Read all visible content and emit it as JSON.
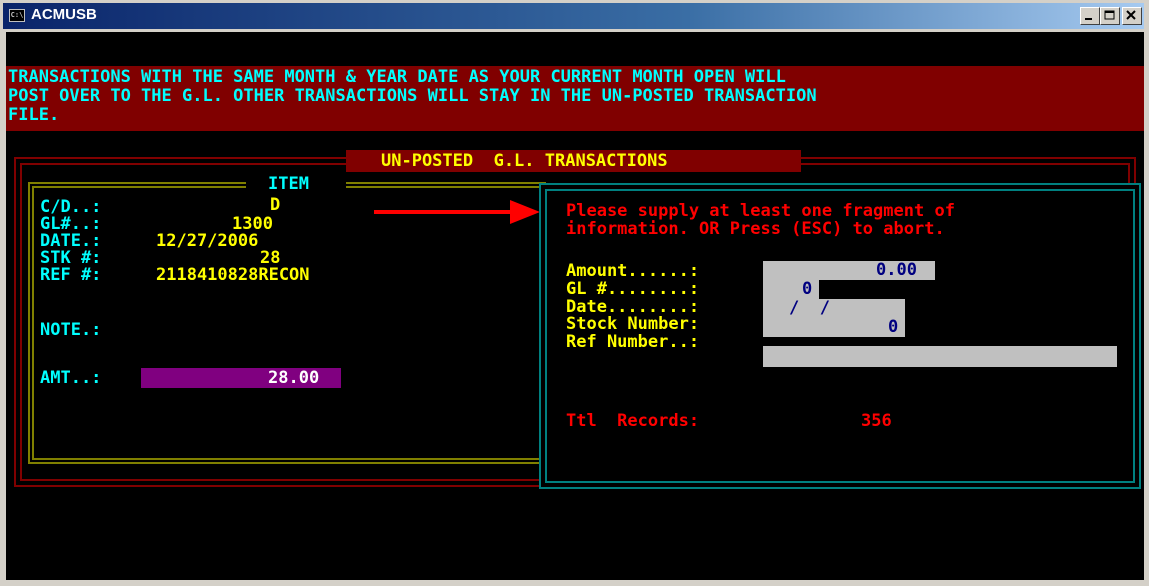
{
  "window": {
    "title": "ACMUSB",
    "icon": "console-icon",
    "icon_text": "C:\\"
  },
  "banner": {
    "lines": [
      "TRANSACTIONS WITH THE SAME MONTH & YEAR DATE AS YOUR CURRENT MONTH OPEN WILL",
      "POST OVER TO THE G.L. OTHER TRANSACTIONS WILL STAY IN THE UN-POSTED TRANSACTION",
      "FILE."
    ]
  },
  "panel_title": "UN-POSTED  G.L. TRANSACTIONS",
  "item": {
    "heading": "ITEM",
    "fields": [
      {
        "label": "C/D..:",
        "value": "D"
      },
      {
        "label": "GL#..:",
        "value": "1300"
      },
      {
        "label": "DATE.:",
        "value": "12/27/2006"
      },
      {
        "label": "STK #:",
        "value": "28"
      },
      {
        "label": "REF #:",
        "value": "2118410828RECON"
      }
    ],
    "note_label": "NOTE.:",
    "amt_label": "AMT..:",
    "amt_value": "28.00"
  },
  "dialog": {
    "message": [
      "Please supply at least one fragment of",
      "information. OR Press (ESC) to abort."
    ],
    "fields": [
      {
        "label": "Amount......:",
        "value": "0.00"
      },
      {
        "label": "GL #........:",
        "value": "0"
      },
      {
        "label": "Date........:",
        "value": "/  /"
      },
      {
        "label": "Stock Number:",
        "value": "0"
      },
      {
        "label": "Ref Number..:",
        "value": ""
      }
    ],
    "total_label": "Ttl  Records:",
    "total_value": "356"
  },
  "colors": {
    "banner_bg": "#800000",
    "banner_text": "#00ffff",
    "item_label": "#00ffff",
    "item_value": "#ffff00",
    "dialog_message": "#ff0000",
    "dialog_label": "#ffff00",
    "field_bg": "#c0c0c0",
    "field_text": "#000080",
    "amt_bg": "#800080",
    "arrow": "#ff0000"
  }
}
